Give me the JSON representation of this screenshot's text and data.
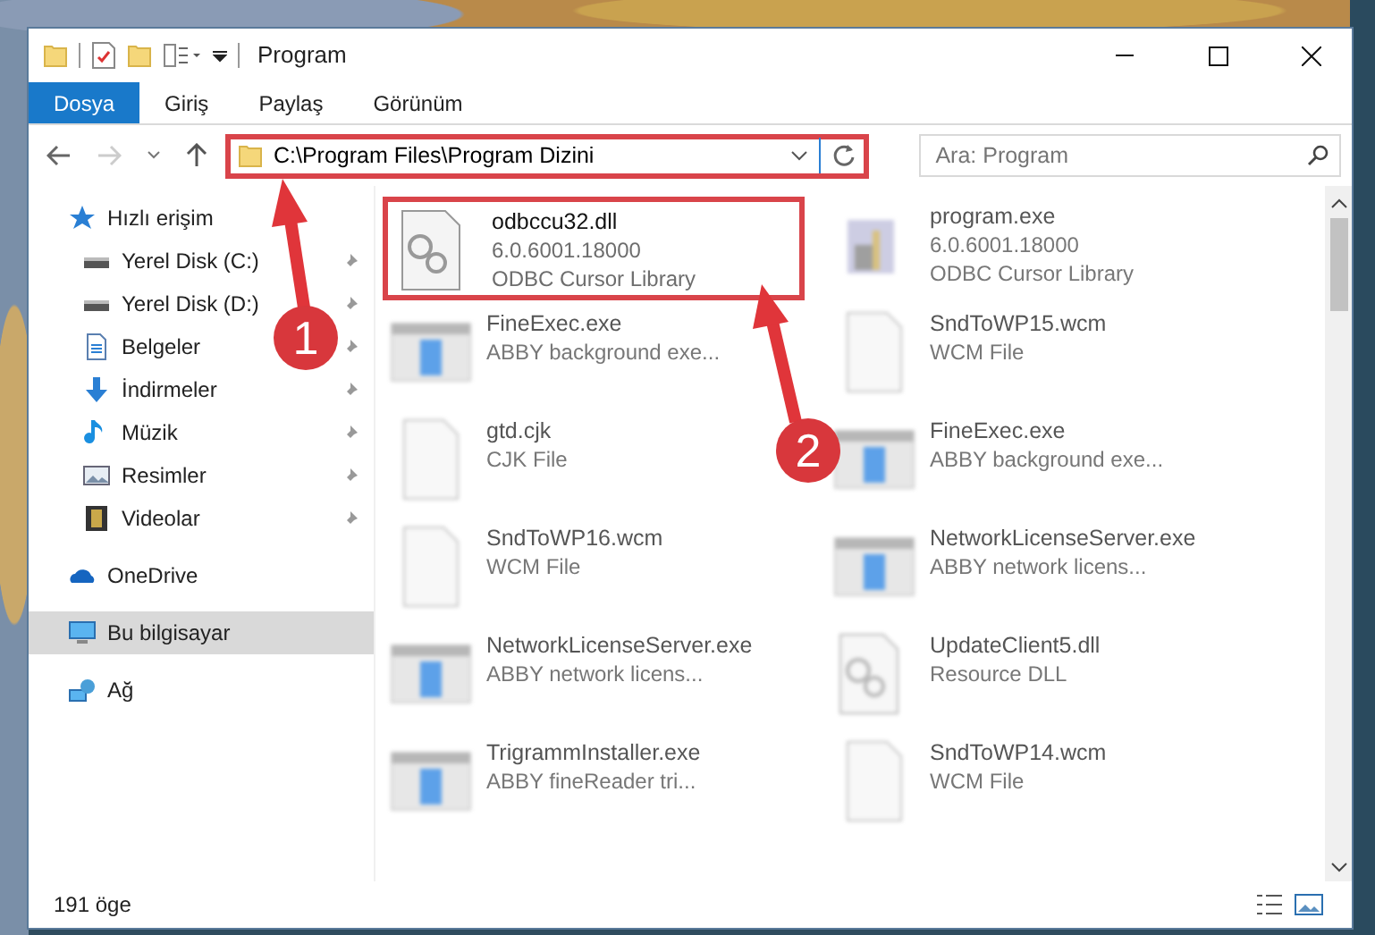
{
  "window": {
    "title": "Program"
  },
  "ribbon_tabs": [
    {
      "label": "Dosya",
      "selected": true
    },
    {
      "label": "Giriş",
      "selected": false
    },
    {
      "label": "Paylaş",
      "selected": false
    },
    {
      "label": "Görünüm",
      "selected": false
    }
  ],
  "address_bar": {
    "path": "C:\\Program Files\\Program Dizini",
    "highlighted": true
  },
  "search": {
    "placeholder": "Ara: Program"
  },
  "sidebar": {
    "items": [
      {
        "label": "Hızlı erişim",
        "kind": "star",
        "selected": false,
        "children": [
          {
            "label": "Yerel Disk (C:)",
            "kind": "drive",
            "pinned": true,
            "selected": false
          },
          {
            "label": "Yerel Disk (D:)",
            "kind": "drive",
            "pinned": true,
            "selected": false
          },
          {
            "label": "Belgeler",
            "kind": "document",
            "pinned": true,
            "selected": false
          },
          {
            "label": "İndirmeler",
            "kind": "download",
            "pinned": true,
            "selected": false
          },
          {
            "label": "Müzik",
            "kind": "music",
            "pinned": true,
            "selected": false
          },
          {
            "label": "Resimler",
            "kind": "image",
            "pinned": true,
            "selected": false
          },
          {
            "label": "Videolar",
            "kind": "video",
            "pinned": true,
            "selected": false
          }
        ]
      },
      {
        "label": "OneDrive",
        "kind": "cloud",
        "selected": false
      },
      {
        "label": "Bu bilgisayar",
        "kind": "computer",
        "selected": true
      },
      {
        "label": "Ağ",
        "kind": "network",
        "selected": false
      }
    ]
  },
  "files": [
    {
      "name": "odbccu32.dll",
      "details": [
        "6.0.6001.18000",
        "ODBC Cursor Library"
      ],
      "kind": "dll",
      "highlighted": true,
      "blurred": false
    },
    {
      "name": "program.exe",
      "details": [
        "6.0.6001.18000",
        "ODBC Cursor Library"
      ],
      "kind": "program",
      "highlighted": false,
      "blurred": true
    },
    {
      "name": "FineExec.exe",
      "details": [
        "ABBY background exe..."
      ],
      "kind": "exe",
      "highlighted": false,
      "blurred": true
    },
    {
      "name": "SndToWP15.wcm",
      "details": [
        "WCM File"
      ],
      "kind": "file",
      "highlighted": false,
      "blurred": true
    },
    {
      "name": "gtd.cjk",
      "details": [
        "CJK File"
      ],
      "kind": "file",
      "highlighted": false,
      "blurred": true
    },
    {
      "name": "FineExec.exe",
      "details": [
        "ABBY background exe..."
      ],
      "kind": "exe",
      "highlighted": false,
      "blurred": true
    },
    {
      "name": "SndToWP16.wcm",
      "details": [
        "WCM File"
      ],
      "kind": "file",
      "highlighted": false,
      "blurred": true
    },
    {
      "name": "NetworkLicenseServer.exe",
      "details": [
        "ABBY network licens..."
      ],
      "kind": "exe",
      "highlighted": false,
      "blurred": true
    },
    {
      "name": "NetworkLicenseServer.exe",
      "details": [
        "ABBY network licens..."
      ],
      "kind": "exe",
      "highlighted": false,
      "blurred": true
    },
    {
      "name": "UpdateClient5.dll",
      "details": [
        "Resource DLL"
      ],
      "kind": "dll",
      "highlighted": false,
      "blurred": true
    },
    {
      "name": "TrigrammInstaller.exe",
      "details": [
        "ABBY fineReader tri..."
      ],
      "kind": "exe",
      "highlighted": false,
      "blurred": true
    },
    {
      "name": "SndToWP14.wcm",
      "details": [
        "WCM File"
      ],
      "kind": "file",
      "highlighted": false,
      "blurred": true
    }
  ],
  "callouts": [
    {
      "number": "1"
    },
    {
      "number": "2"
    }
  ],
  "status_bar": {
    "count": "191 öge"
  }
}
